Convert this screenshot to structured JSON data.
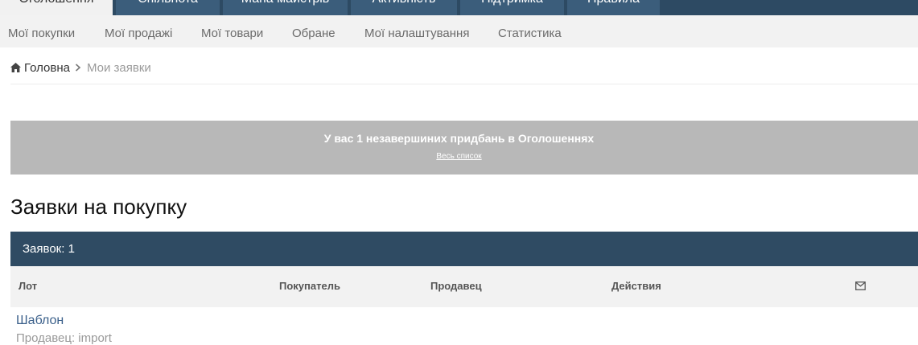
{
  "topnav": {
    "tabs": [
      {
        "label": "Оголошення",
        "active": true
      },
      {
        "label": "Спільнота",
        "active": false
      },
      {
        "label": "Мапа майстрів",
        "active": false
      },
      {
        "label": "Активність",
        "active": false
      },
      {
        "label": "Підтримка",
        "active": false
      },
      {
        "label": "Правила",
        "active": false
      }
    ]
  },
  "subnav": {
    "items": [
      {
        "label": "Мої покупки"
      },
      {
        "label": "Мої продажі"
      },
      {
        "label": "Мої товари"
      },
      {
        "label": "Обране"
      },
      {
        "label": "Мої налаштування"
      },
      {
        "label": "Статистика"
      }
    ]
  },
  "breadcrumb": {
    "home": "Головна",
    "current": "Мои заявки"
  },
  "notice": {
    "text": "У вас 1 незавершиних придбань в Оголошеннях",
    "link": "Весь список"
  },
  "page": {
    "title": "Заявки на покупку"
  },
  "table": {
    "count_label": "Заявок: 1",
    "headers": {
      "lot": "Лот",
      "buyer": "Покупатель",
      "seller": "Продавец",
      "actions": "Действия",
      "mail_icon": "envelope-icon"
    },
    "rows": [
      {
        "lot_title": "Шаблон",
        "lot_seller": "Продавец: import"
      }
    ]
  },
  "colors": {
    "nav_bg": "#2d4a63",
    "panel_header_bg": "#2f4b63",
    "notice_bg": "#b8b8b8",
    "link": "#3a5f8a"
  }
}
